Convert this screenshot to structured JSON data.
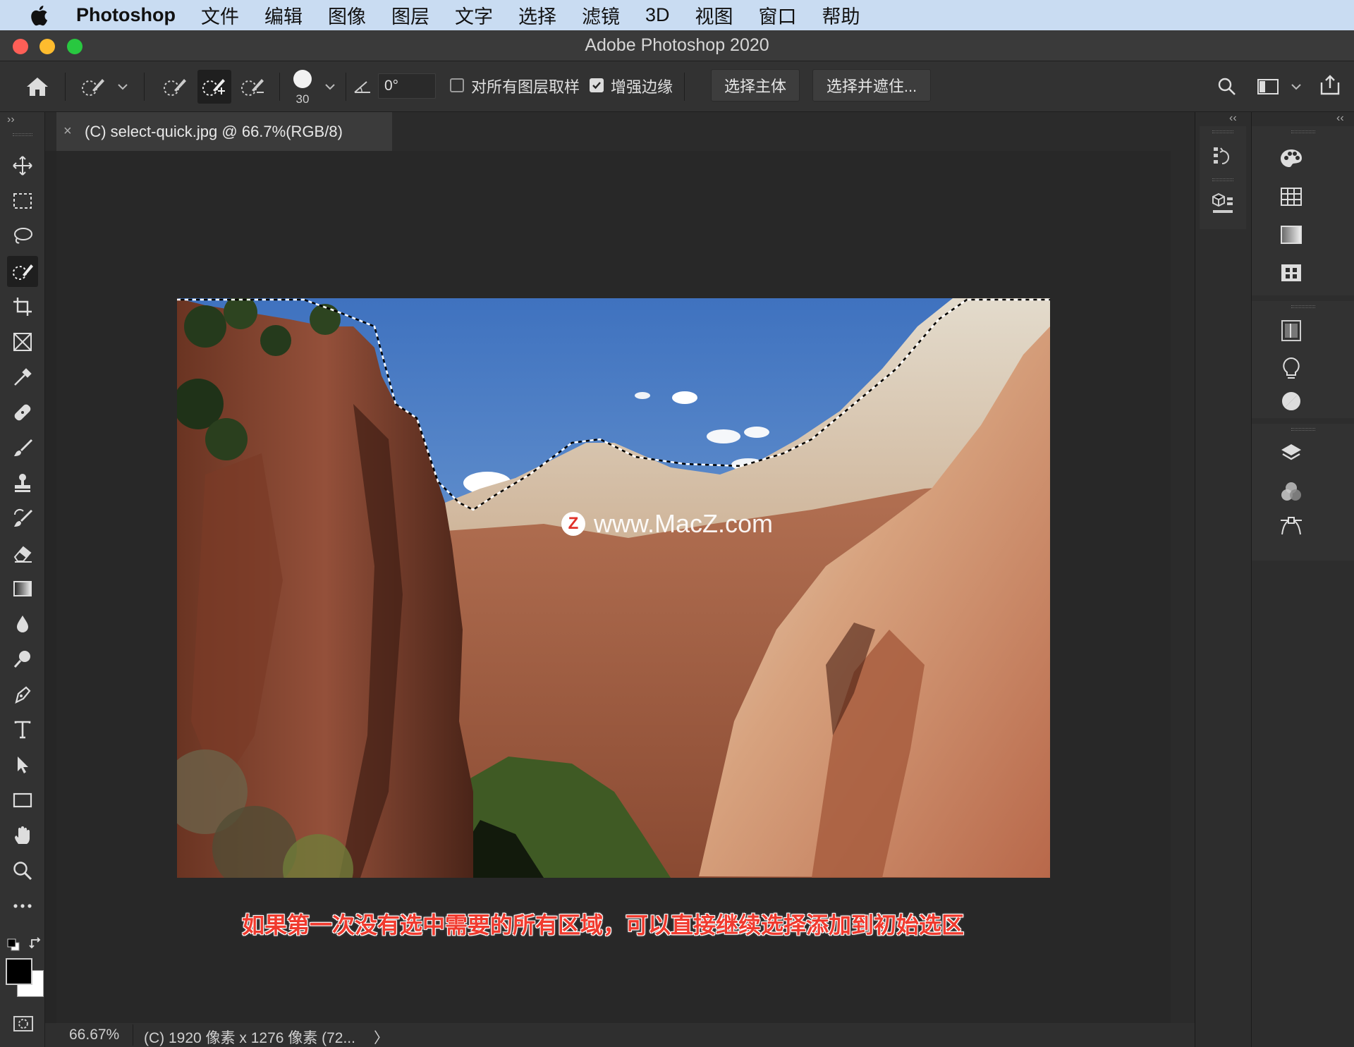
{
  "menubar": {
    "app_name": "Photoshop",
    "items": [
      "文件",
      "编辑",
      "图像",
      "图层",
      "文字",
      "选择",
      "滤镜",
      "3D",
      "视图",
      "窗口",
      "帮助"
    ]
  },
  "window": {
    "title": "Adobe Photoshop 2020"
  },
  "options": {
    "brush_size": "30",
    "angle_value": "0°",
    "sample_all_layers_label": "对所有图层取样",
    "sample_all_layers_checked": false,
    "enhance_edge_label": "增强边缘",
    "enhance_edge_checked": true,
    "select_subject_label": "选择主体",
    "select_and_mask_label": "选择并遮住..."
  },
  "document": {
    "tab_label": "(C) select-quick.jpg @ 66.7%(RGB/8)",
    "close_symbol": "×"
  },
  "canvas": {
    "watermark_text": "www.MacZ.com",
    "watermark_logo": "Z",
    "subtitle": "如果第一次没有选中需要的所有区域，可以直接继续选择添加到初始选区"
  },
  "status": {
    "zoom": "66.67%",
    "info": "(C) 1920 像素 x 1276 像素 (72...",
    "arrow": "〉"
  },
  "toolbar": {
    "tools": [
      "move-tool",
      "rectangular-marquee-tool",
      "lasso-tool",
      "quick-selection-tool",
      "crop-tool",
      "frame-tool",
      "eyedropper-tool",
      "healing-brush-tool",
      "brush-tool",
      "clone-stamp-tool",
      "history-brush-tool",
      "eraser-tool",
      "gradient-tool",
      "blur-tool",
      "dodge-tool",
      "pen-tool",
      "type-tool",
      "path-selection-tool",
      "rectangle-tool",
      "hand-tool",
      "zoom-tool",
      "more-tools"
    ],
    "active_tool": "quick-selection-tool",
    "foreground_color": "#000000",
    "background_color": "#ffffff"
  },
  "colors": {
    "menubar_bg": "#c9dcf2",
    "subtitle_red": "#f03a2e",
    "traffic_red": "#fe5f57",
    "traffic_yellow": "#febc2e",
    "traffic_green": "#28c840"
  }
}
